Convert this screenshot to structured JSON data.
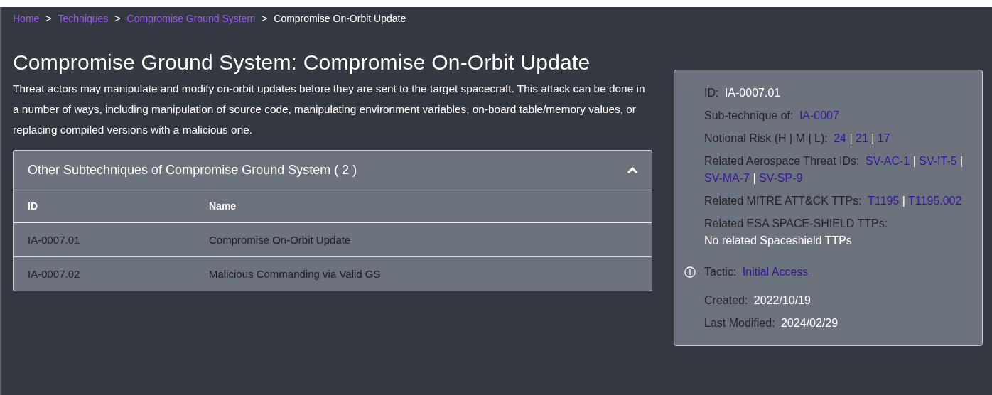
{
  "breadcrumb": [
    {
      "text": "Home",
      "kind": "link"
    },
    {
      "text": ">",
      "kind": "sep"
    },
    {
      "text": "Techniques",
      "kind": "link"
    },
    {
      "text": ">",
      "kind": "sep"
    },
    {
      "text": "Compromise Ground System",
      "kind": "link"
    },
    {
      "text": ">",
      "kind": "sep"
    },
    {
      "text": "Compromise On-Orbit Update",
      "kind": "current"
    }
  ],
  "title": "Compromise Ground System: Compromise On-Orbit Update",
  "description": "Threat actors may manipulate and modify on-orbit updates before they are sent to the target spacecraft. This attack can be done in a number of ways, including manipulation of source code, manipulating environment variables, on-board table/memory values, or replacing compiled versions with a malicious one.",
  "subtechniques": {
    "title": "Other Subtechniques of Compromise Ground System ( 2 )",
    "expanded": true,
    "columns": [
      "ID",
      "Name"
    ],
    "rows": [
      [
        "IA-0007.01",
        "Compromise On-Orbit Update"
      ],
      [
        "IA-0007.02",
        "Malicious Commanding via Valid GS"
      ]
    ]
  },
  "info": [
    {
      "label": "ID:",
      "icon": false,
      "parts": [
        {
          "kind": "value",
          "text": "IA-0007.01"
        }
      ]
    },
    {
      "label": "Sub-technique of:",
      "icon": false,
      "parts": [
        {
          "kind": "link",
          "text": "IA-0007"
        }
      ]
    },
    {
      "label": "Notional Risk (H | M | L):",
      "icon": false,
      "parts": [
        {
          "kind": "link",
          "text": "24"
        },
        {
          "kind": "sep",
          "text": "|"
        },
        {
          "kind": "link",
          "text": "21"
        },
        {
          "kind": "sep",
          "text": "|"
        },
        {
          "kind": "link",
          "text": "17"
        }
      ]
    },
    {
      "label": "Related Aerospace Threat IDs:",
      "icon": false,
      "parts": [
        {
          "kind": "link",
          "text": "SV-AC-1"
        },
        {
          "kind": "sep",
          "text": "|"
        },
        {
          "kind": "link",
          "text": "SV-IT-5"
        },
        {
          "kind": "sep",
          "text": "|"
        },
        {
          "kind": "link",
          "text": "SV-MA-7"
        },
        {
          "kind": "sep",
          "text": "|"
        },
        {
          "kind": "link",
          "text": "SV-SP-9"
        }
      ]
    },
    {
      "label": "Related MITRE ATT&CK TTPs:",
      "icon": false,
      "parts": [
        {
          "kind": "link",
          "text": "T1195"
        },
        {
          "kind": "sep",
          "text": "|"
        },
        {
          "kind": "link",
          "text": "T1195.002"
        }
      ]
    },
    {
      "label": "Related ESA SPACE-SHIELD TTPs:",
      "icon": false,
      "parts": [
        {
          "kind": "block",
          "text": "No related Spaceshield TTPs"
        }
      ]
    },
    {
      "label": "Tactic:",
      "icon": true,
      "parts": [
        {
          "kind": "link",
          "text": "Initial Access"
        }
      ]
    },
    {
      "label": "Created:",
      "icon": false,
      "parts": [
        {
          "kind": "value",
          "text": "2022/10/19"
        }
      ]
    },
    {
      "label": "Last Modified:",
      "icon": false,
      "parts": [
        {
          "kind": "value",
          "text": "2024/02/29"
        }
      ]
    }
  ]
}
